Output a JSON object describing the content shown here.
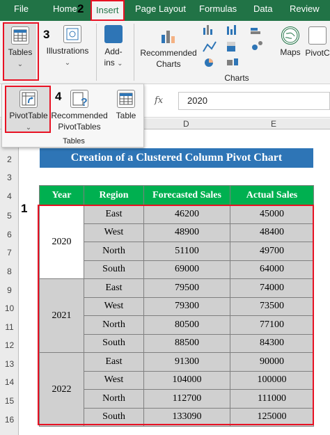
{
  "tabs": {
    "file": "File",
    "home": "Home",
    "insert": "Insert",
    "page_layout": "Page Layout",
    "formulas": "Formulas",
    "data": "Data",
    "review": "Review"
  },
  "ribbon": {
    "tables": "Tables",
    "illustrations": "Illustrations",
    "addins_line1": "Add-",
    "addins_line2": "ins",
    "recommended_line1": "Recommended",
    "recommended_line2": "Charts",
    "maps": "Maps",
    "pivotchart": "PivotC",
    "charts_group": "Charts"
  },
  "dropdown": {
    "pivottable": "PivotTable",
    "rec_pivot_line1": "Recommended",
    "rec_pivot_line2": "PivotTables",
    "table": "Table",
    "group": "Tables"
  },
  "formula_bar": {
    "fx": "fx",
    "value": "2020"
  },
  "columns": {
    "d": "D",
    "e": "E"
  },
  "rows": [
    "2",
    "3",
    "4",
    "5",
    "6",
    "7",
    "8",
    "9",
    "10",
    "11",
    "12",
    "13",
    "14",
    "15",
    "16"
  ],
  "markers": {
    "m1": "1",
    "m2": "2",
    "m3": "3",
    "m4": "4"
  },
  "sheet_title": "Creation of a Clustered Column Pivot Chart",
  "table": {
    "headers": [
      "Year",
      "Region",
      "Forecasted Sales",
      "Actual Sales"
    ],
    "years": [
      "2020",
      "2021",
      "2022"
    ],
    "rows": [
      {
        "region": "East",
        "forecast": "46200",
        "actual": "45000"
      },
      {
        "region": "West",
        "forecast": "48900",
        "actual": "48400"
      },
      {
        "region": "North",
        "forecast": "51100",
        "actual": "49700"
      },
      {
        "region": "South",
        "forecast": "69000",
        "actual": "64000"
      },
      {
        "region": "East",
        "forecast": "79500",
        "actual": "74000"
      },
      {
        "region": "West",
        "forecast": "79300",
        "actual": "73500"
      },
      {
        "region": "North",
        "forecast": "80500",
        "actual": "77100"
      },
      {
        "region": "South",
        "forecast": "88500",
        "actual": "84300"
      },
      {
        "region": "East",
        "forecast": "91300",
        "actual": "90000"
      },
      {
        "region": "West",
        "forecast": "104000",
        "actual": "100000"
      },
      {
        "region": "North",
        "forecast": "112700",
        "actual": "111000"
      },
      {
        "region": "South",
        "forecast": "133090",
        "actual": "125000"
      }
    ]
  },
  "colors": {
    "excel_green": "#217346",
    "header_green": "#00b050",
    "title_blue": "#2e75b6",
    "highlight_red": "#e81123"
  }
}
